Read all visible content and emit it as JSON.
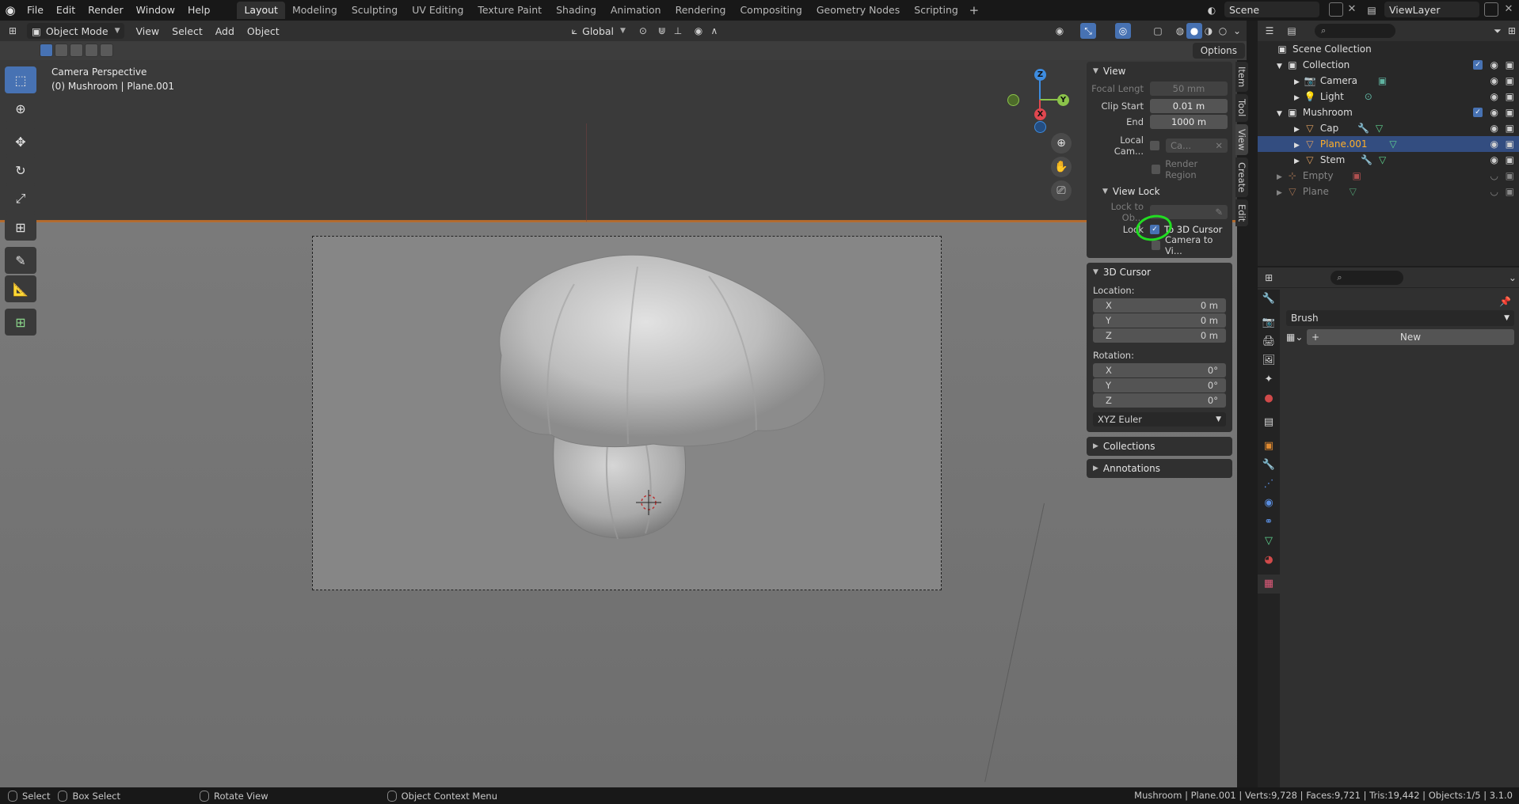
{
  "menu": [
    "File",
    "Edit",
    "Render",
    "Window",
    "Help"
  ],
  "workspaces": [
    "Layout",
    "Modeling",
    "Sculpting",
    "UV Editing",
    "Texture Paint",
    "Shading",
    "Animation",
    "Rendering",
    "Compositing",
    "Geometry Nodes",
    "Scripting"
  ],
  "active_workspace": "Layout",
  "scene": "Scene",
  "view_layer": "ViewLayer",
  "viewport_header": {
    "mode": "Object Mode",
    "menus": [
      "View",
      "Select",
      "Add",
      "Object"
    ],
    "orientation": "Global"
  },
  "options_label": "Options",
  "viewport_info": {
    "line1": "Camera Perspective",
    "line2": "(0) Mushroom | Plane.001"
  },
  "gizmo": {
    "z": "Z",
    "y": "Y",
    "x": "X"
  },
  "npanel": {
    "view_title": "View",
    "focal_label": "Focal Lengt",
    "focal_value": "50 mm",
    "clip_start_label": "Clip Start",
    "clip_start_value": "0.01 m",
    "end_label": "End",
    "end_value": "1000 m",
    "local_cam_label": "Local Cam...",
    "local_cam_value": "Ca...",
    "render_region": "Render Region",
    "view_lock_title": "View Lock",
    "lock_to_obj_label": "Lock to Ob...",
    "lock_label": "Lock",
    "to_3d_cursor": "To 3D Cursor",
    "camera_to_view": "Camera to Vi...",
    "cursor_title": "3D Cursor",
    "location_label": "Location:",
    "rotation_label": "Rotation:",
    "loc": [
      {
        "axis": "X",
        "value": "0 m"
      },
      {
        "axis": "Y",
        "value": "0 m"
      },
      {
        "axis": "Z",
        "value": "0 m"
      }
    ],
    "rot": [
      {
        "axis": "X",
        "value": "0°"
      },
      {
        "axis": "Y",
        "value": "0°"
      },
      {
        "axis": "Z",
        "value": "0°"
      }
    ],
    "rotation_mode": "XYZ Euler",
    "collections": "Collections",
    "annotations": "Annotations",
    "tabs": [
      "Item",
      "Tool",
      "View",
      "Create",
      "Edit"
    ]
  },
  "outliner": {
    "root": "Scene Collection",
    "collection": "Collection",
    "camera": "Camera",
    "light": "Light",
    "mushroom": "Mushroom",
    "cap": "Cap",
    "plane001": "Plane.001",
    "stem": "Stem",
    "empty": "Empty",
    "plane": "Plane"
  },
  "properties": {
    "brush": "Brush",
    "new": "New"
  },
  "status": {
    "select": "Select",
    "box_select": "Box Select",
    "rotate_view": "Rotate View",
    "context_menu": "Object Context Menu",
    "stats": "Mushroom | Plane.001 | Verts:9,728 | Faces:9,721 | Tris:19,442 | Objects:1/5 | 3.1.0"
  },
  "colors": {
    "accent": "#4772b3",
    "selection": "#334d80",
    "highlight_circle": "#22dd22",
    "x_axis": "#e0474f",
    "y_axis": "#8bc34a",
    "z_axis": "#3d8ce0"
  }
}
